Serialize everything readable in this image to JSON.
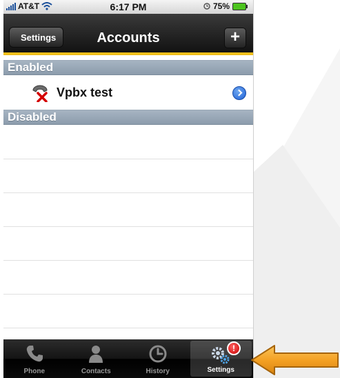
{
  "status_bar": {
    "carrier": "AT&T",
    "time": "6:17 PM",
    "battery": "75%"
  },
  "nav": {
    "back_label": "Settings",
    "title": "Accounts",
    "add_label": "+"
  },
  "sections": {
    "enabled": "Enabled",
    "disabled": "Disabled"
  },
  "accounts": [
    {
      "name": "Vpbx test",
      "status": "disconnected"
    }
  ],
  "tabs": [
    {
      "label": "Phone",
      "icon": "phone-icon"
    },
    {
      "label": "Contacts",
      "icon": "contacts-icon"
    },
    {
      "label": "History",
      "icon": "history-icon"
    },
    {
      "label": "Settings",
      "icon": "settings-icon",
      "badge": "!"
    }
  ],
  "colors": {
    "accent_yellow": "#f1bf1a",
    "arrow_orange": "#f4a124",
    "section_header": "#96a5b4"
  }
}
